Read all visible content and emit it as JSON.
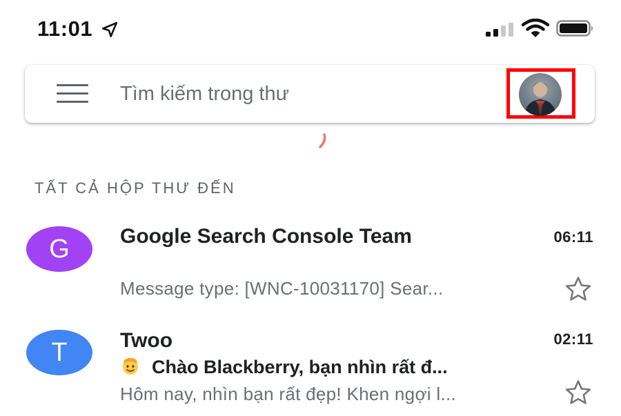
{
  "status_bar": {
    "time": "11:01",
    "icons": [
      "location-arrow-icon",
      "cellular-signal-icon",
      "wifi-icon",
      "battery-icon"
    ]
  },
  "search": {
    "placeholder": "Tìm kiếm trong thư",
    "menu_icon": "hamburger-menu-icon",
    "avatar_icon": "account-avatar",
    "highlight_color": "#ff0000"
  },
  "section": {
    "title": "TẤT CẢ HỘP THƯ ĐẾN"
  },
  "emails": [
    {
      "avatar_letter": "G",
      "avatar_color": "#a142f4",
      "sender": "Google Search Console Team",
      "time": "06:11",
      "snippet": "Message type: [WNC-10031170] Sear...",
      "starred": false
    },
    {
      "avatar_letter": "T",
      "avatar_color": "#4285f4",
      "sender": "Twoo",
      "time": "02:11",
      "subject": "Chào Blackberry, bạn nhìn rất đ...",
      "subject_icon": "smiling-face-emoji-icon",
      "snippet": "Hôm nay, nhìn bạn rất đẹp! Khen ngợi l...",
      "starred": false
    }
  ]
}
